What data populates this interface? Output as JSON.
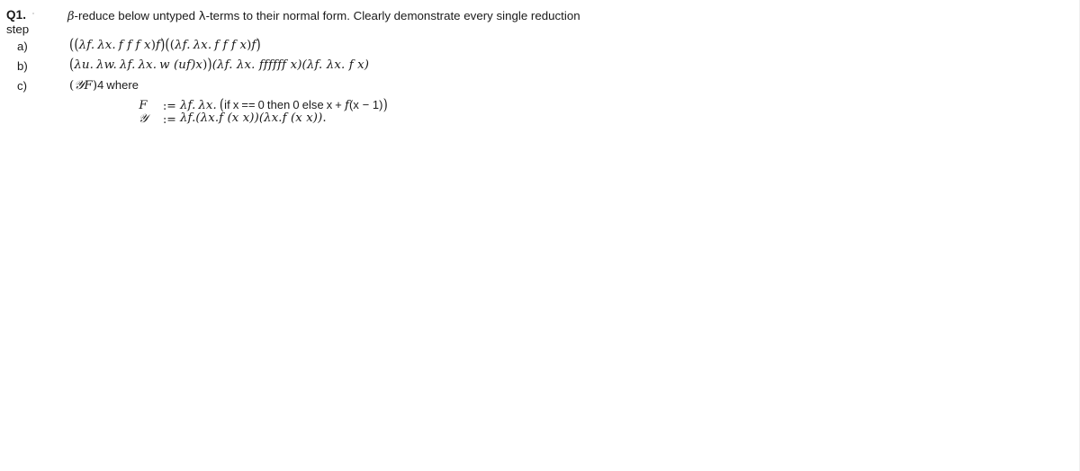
{
  "document": {
    "question_label": "Q1.",
    "statement_line1": "-reduce below untyped ",
    "statement_beta": "β",
    "statement_lambda": "λ",
    "statement_line1_tail": "-terms to their normal form. Clearly demonstrate every single reduction",
    "statement_line2": "step"
  },
  "items": [
    {
      "label": "a)",
      "expression": "((λf. λx. f f f x)f)((λf. λx. f f f x)f)",
      "parts": {
        "open1": "(",
        "open2": "(",
        "lam_f": "λf.",
        "lam_x": "λx.",
        "body": "f f f x",
        "close_inner": ")",
        "arg": "f",
        "close_outer": ")"
      }
    },
    {
      "label": "b)",
      "expression": "(λu. λw. λf. λx. w (uf)x))(λf. λx. ffffff x)(λf. λx. f x)",
      "parts": {
        "lam_u": "λu.",
        "lam_w": "λw.",
        "lam_f": "λf.",
        "lam_x": "λx.",
        "body": "w (uf)x",
        "second_term": "(λf. λx. ffffff x)",
        "third_term": "(λf. λx. f x)"
      }
    },
    {
      "label": "c)",
      "expression": "(\u0001F)4 where",
      "parts": {
        "open": "(",
        "y_combinator": "𝒴",
        "f_symbol": "F",
        "close": ")",
        "numeral": "4",
        "where": "where"
      }
    }
  ],
  "definitions": [
    {
      "name": "F",
      "assign": ":=",
      "value": "λf. λx. (if x == 0 then 0 else x + f(x − 1))",
      "parts": {
        "lam_f": "λf.",
        "lam_x": "λx.",
        "open_paren": "(",
        "if_kw": "if",
        "var_x": "x",
        "eq": "==",
        "zero": "0",
        "then_kw": "then",
        "then_val": "0",
        "else_kw": "else",
        "else_x": "x",
        "plus": "+",
        "fn": "f",
        "arg": "(x − 1)",
        "close_paren": ")"
      }
    },
    {
      "name": "𝒴",
      "assign": ":=",
      "value": "λf.(λx.f (x x))(λx.f (x x)).",
      "parts": {
        "lam_f": "λf.",
        "term1": "(λx.f (x x))",
        "term2": "(λx.f (x x))",
        "period": "."
      }
    }
  ],
  "colors": {
    "text": "#1a1a1a",
    "background": "#ffffff",
    "faint_mark": "#cfcfcf"
  }
}
